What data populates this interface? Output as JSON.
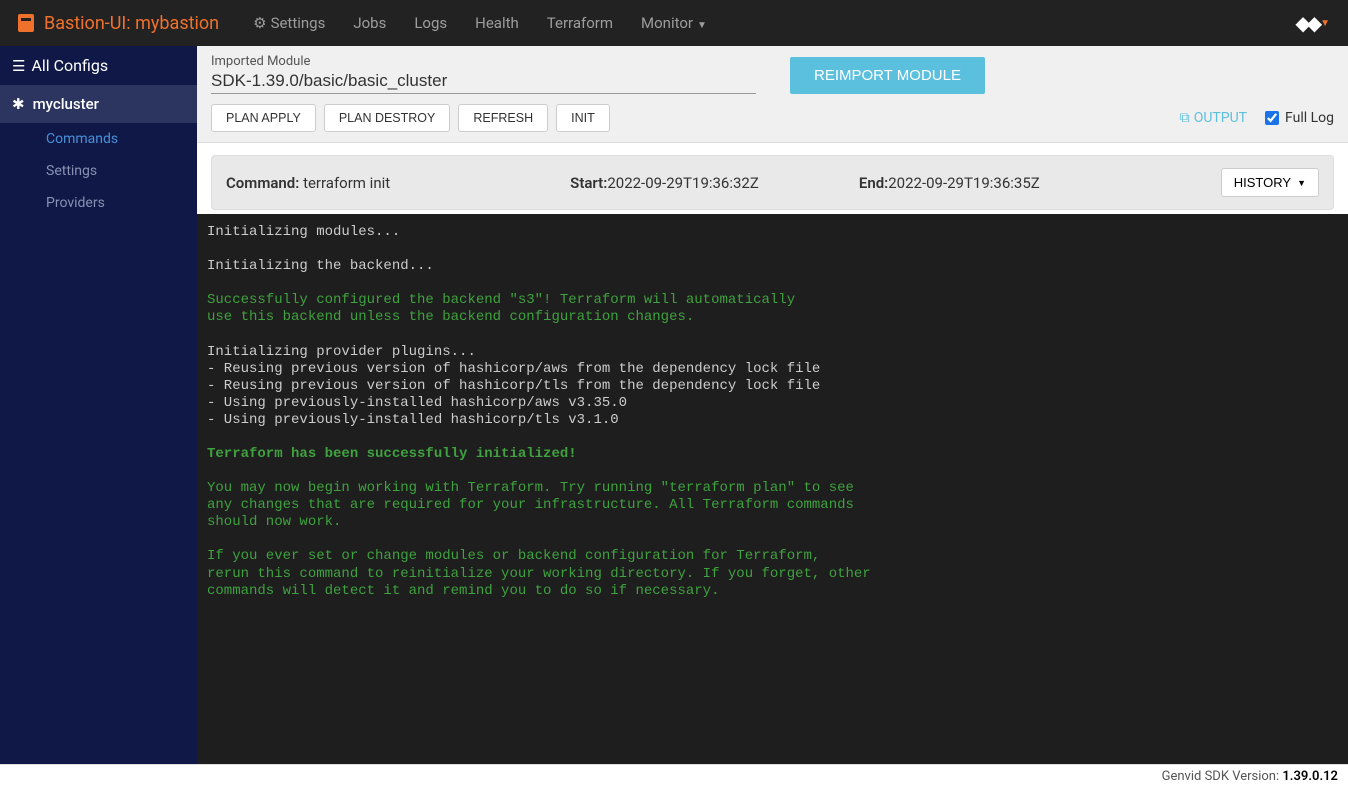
{
  "brand": "Bastion-UI: mybastion",
  "topnav": {
    "settings": "Settings",
    "jobs": "Jobs",
    "logs": "Logs",
    "health": "Health",
    "terraform": "Terraform",
    "monitor": "Monitor"
  },
  "sidebar": {
    "all_configs": "All Configs",
    "cluster": "mycluster",
    "items": [
      "Commands",
      "Settings",
      "Providers"
    ],
    "active_index": 0
  },
  "module": {
    "label": "Imported Module",
    "value": "SDK-1.39.0/basic/basic_cluster",
    "reimport": "REIMPORT MODULE"
  },
  "actions": {
    "plan_apply": "PLAN APPLY",
    "plan_destroy": "PLAN DESTROY",
    "refresh": "REFRESH",
    "init": "INIT",
    "output": "OUTPUT",
    "full_log": "Full Log",
    "full_log_checked": true
  },
  "status": {
    "command_label": "Command:",
    "command_value": "terraform init",
    "start_label": "Start:",
    "start_value": "2022-09-29T19:36:32Z",
    "end_label": "End:",
    "end_value": "2022-09-29T19:36:35Z",
    "history": "HISTORY"
  },
  "terminal": {
    "l1": "Initializing modules...",
    "l2": "Initializing the backend...",
    "l3": "Successfully configured the backend \"s3\"! Terraform will automatically",
    "l4": "use this backend unless the backend configuration changes.",
    "l5": "Initializing provider plugins...",
    "l6": "- Reusing previous version of hashicorp/aws from the dependency lock file",
    "l7": "- Reusing previous version of hashicorp/tls from the dependency lock file",
    "l8": "- Using previously-installed hashicorp/aws v3.35.0",
    "l9": "- Using previously-installed hashicorp/tls v3.1.0",
    "l10": "Terraform has been successfully initialized!",
    "l11": "You may now begin working with Terraform. Try running \"terraform plan\" to see",
    "l12": "any changes that are required for your infrastructure. All Terraform commands",
    "l13": "should now work.",
    "l14": "If you ever set or change modules or backend configuration for Terraform,",
    "l15": "rerun this command to reinitialize your working directory. If you forget, other",
    "l16": "commands will detect it and remind you to do so if necessary."
  },
  "footer": {
    "label": "Genvid SDK Version: ",
    "version": "1.39.0.12"
  }
}
